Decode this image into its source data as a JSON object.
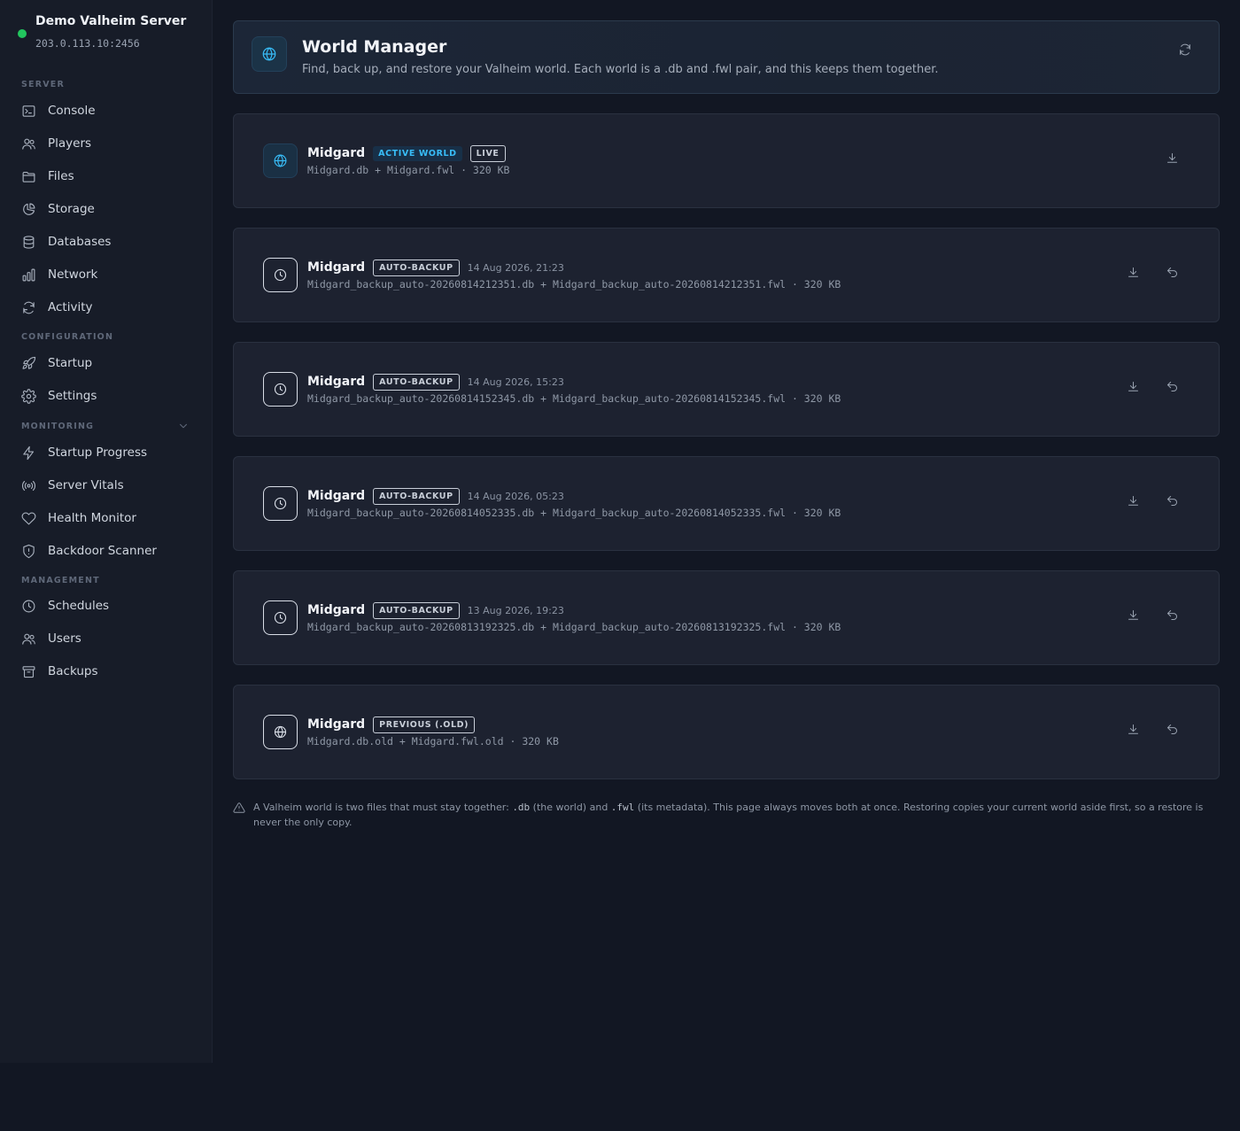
{
  "server": {
    "name": "Demo Valheim Server",
    "address": "203.0.113.10:2456",
    "status_color": "#22c55e"
  },
  "sidebar": {
    "sections": [
      {
        "title": "SERVER",
        "items": [
          {
            "label": "Console",
            "icon": "terminal-icon"
          },
          {
            "label": "Players",
            "icon": "users-icon"
          },
          {
            "label": "Files",
            "icon": "folder-icon"
          },
          {
            "label": "Storage",
            "icon": "pie-chart-icon"
          },
          {
            "label": "Databases",
            "icon": "database-icon"
          },
          {
            "label": "Network",
            "icon": "bar-chart-icon"
          },
          {
            "label": "Activity",
            "icon": "refresh-icon"
          }
        ]
      },
      {
        "title": "CONFIGURATION",
        "items": [
          {
            "label": "Startup",
            "icon": "rocket-icon"
          },
          {
            "label": "Settings",
            "icon": "gear-icon"
          }
        ]
      },
      {
        "title": "MONITORING",
        "collapsible": true,
        "items": [
          {
            "label": "Startup Progress",
            "icon": "bolt-icon"
          },
          {
            "label": "Server Vitals",
            "icon": "radio-icon"
          },
          {
            "label": "Health Monitor",
            "icon": "heart-icon"
          },
          {
            "label": "Backdoor Scanner",
            "icon": "shield-icon"
          }
        ]
      },
      {
        "title": "MANAGEMENT",
        "items": [
          {
            "label": "Schedules",
            "icon": "clock-icon"
          },
          {
            "label": "Users",
            "icon": "users-icon"
          },
          {
            "label": "Backups",
            "icon": "archive-icon"
          }
        ]
      }
    ]
  },
  "header": {
    "title": "World Manager",
    "subtitle": "Find, back up, and restore your Valheim world. Each world is a .db and .fwl pair, and this keeps them together.",
    "icon": "globe-icon",
    "refresh_icon": "refresh-icon"
  },
  "worlds": [
    {
      "name": "Midgard",
      "icon": "globe-icon",
      "badges": [
        {
          "label": "ACTIVE WORLD",
          "style": "active"
        },
        {
          "label": "LIVE",
          "style": "outline"
        }
      ],
      "date": "",
      "files": "Midgard.db + Midgard.fwl · 320 KB",
      "actions": [
        "download"
      ]
    },
    {
      "name": "Midgard",
      "icon": "clock-icon",
      "badges": [
        {
          "label": "AUTO-BACKUP",
          "style": "outline"
        }
      ],
      "date": "14 Aug 2026, 21:23",
      "files": "Midgard_backup_auto-20260814212351.db + Midgard_backup_auto-20260814212351.fwl · 320 KB",
      "actions": [
        "download",
        "restore"
      ]
    },
    {
      "name": "Midgard",
      "icon": "clock-icon",
      "badges": [
        {
          "label": "AUTO-BACKUP",
          "style": "outline"
        }
      ],
      "date": "14 Aug 2026, 15:23",
      "files": "Midgard_backup_auto-20260814152345.db + Midgard_backup_auto-20260814152345.fwl · 320 KB",
      "actions": [
        "download",
        "restore"
      ]
    },
    {
      "name": "Midgard",
      "icon": "clock-icon",
      "badges": [
        {
          "label": "AUTO-BACKUP",
          "style": "outline"
        }
      ],
      "date": "14 Aug 2026, 05:23",
      "files": "Midgard_backup_auto-20260814052335.db + Midgard_backup_auto-20260814052335.fwl · 320 KB",
      "actions": [
        "download",
        "restore"
      ]
    },
    {
      "name": "Midgard",
      "icon": "clock-icon",
      "badges": [
        {
          "label": "AUTO-BACKUP",
          "style": "outline"
        }
      ],
      "date": "13 Aug 2026, 19:23",
      "files": "Midgard_backup_auto-20260813192325.db + Midgard_backup_auto-20260813192325.fwl · 320 KB",
      "actions": [
        "download",
        "restore"
      ]
    },
    {
      "name": "Midgard",
      "icon": "globe-icon",
      "badges": [
        {
          "label": "PREVIOUS (.OLD)",
          "style": "outline"
        }
      ],
      "date": "",
      "files": "Midgard.db.old + Midgard.fwl.old · 320 KB",
      "actions": [
        "download",
        "restore"
      ]
    }
  ],
  "footnote": {
    "icon": "warning-icon",
    "part1": "A Valheim world is two files that must stay together: ",
    "code1": ".db",
    "part2": " (the world) and ",
    "code2": ".fwl",
    "part3": " (its metadata). This page always moves both at once. Restoring copies your current world aside first, so a restore is never the only copy."
  },
  "colors": {
    "accent": "#38bdf8",
    "background": "#121723",
    "sidebar": "#171c28",
    "card": "#1d2230"
  }
}
